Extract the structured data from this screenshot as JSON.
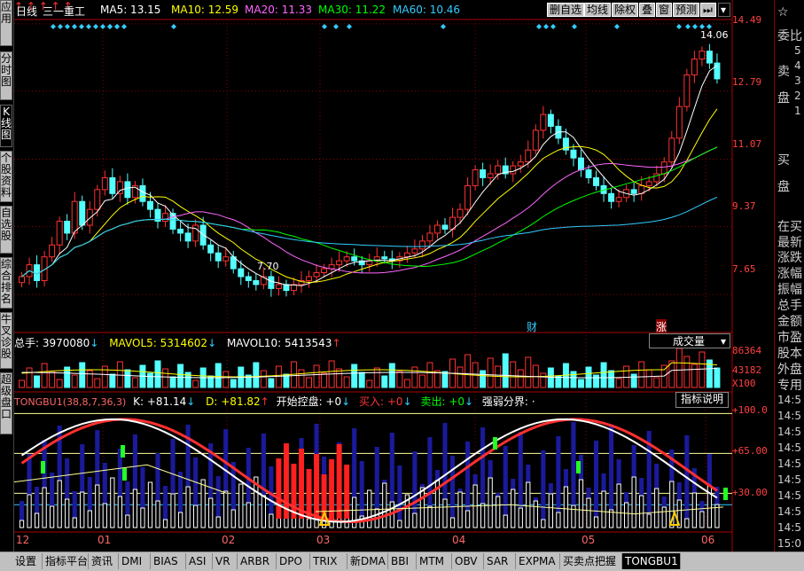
{
  "stock": {
    "chart_label": "日线",
    "name": "三一重工"
  },
  "ma_bar": [
    {
      "label": "MA5: 13.15",
      "color": "#ffffff"
    },
    {
      "label": "MA10: 12.59",
      "color": "#ffff00"
    },
    {
      "label": "MA20: 11.33",
      "color": "#ff66ff"
    },
    {
      "label": "MA30: 11.22",
      "color": "#00ff00"
    },
    {
      "label": "MA60: 10.46",
      "color": "#33ccff"
    }
  ],
  "toolbar": {
    "buttons": [
      "删自选",
      "均线",
      "除权",
      "叠",
      "窗",
      "预测"
    ]
  },
  "left_tabs": [
    "应用",
    "分时图",
    "K线图",
    "个股资料",
    "自选股",
    "综合排名",
    "牛叉诊股",
    "超级盘口"
  ],
  "price_axis": [
    "14.49",
    "12.79",
    "11.07",
    "9.37",
    "7.65"
  ],
  "annotations": {
    "high": "14.06",
    "low": "7.70",
    "event1": "财",
    "event2": "涨"
  },
  "volume_bar": {
    "total": "总手: 3970080",
    "mavol5": "MAVOL5: 5314602",
    "mavol10": "MAVOL10: 5413543",
    "selector": "成交量",
    "axis": [
      "86364",
      "43182",
      "X100"
    ]
  },
  "indicator_bar": {
    "name": "TONGBU1(38,8,7,36,3)",
    "k": "K: +81.14",
    "d": "D: +81.82",
    "kaishi": "开始控盘: +0",
    "mairu": "买入: +0",
    "maichu": "卖出: +0",
    "qiangruo": "强弱分界: ·",
    "help": "指标说明",
    "axis": [
      "+100.0",
      "+65.00",
      "+30.00"
    ]
  },
  "date_axis": [
    "12",
    "01",
    "02",
    "03",
    "04",
    "05",
    "06"
  ],
  "right_panel": {
    "labels": [
      "委比",
      "卖",
      "盘",
      "买",
      "盘",
      "在买",
      "最新",
      "涨跌",
      "涨幅",
      "振幅",
      "总手",
      "金额",
      "市盈",
      "股本",
      "外盘",
      "专用"
    ],
    "times": [
      "14:5",
      "14:5",
      "14:5",
      "14:5",
      "14:5",
      "14:5",
      "14:5",
      "14:5",
      "14:5",
      "15:0"
    ],
    "book": [
      "5",
      "4",
      "3",
      "2",
      "1"
    ]
  },
  "bottom_tabs": [
    "设置",
    "指标平台",
    "资讯",
    "DMI",
    "BIAS",
    "ASI",
    "VR",
    "ARBR",
    "DPO",
    "TRIX",
    "新DMA",
    "BBI",
    "MTM",
    "OBV",
    "SAR",
    "EXPMA",
    "买卖点把握",
    "TONGBU1"
  ],
  "chart_data": {
    "type": "candlestick",
    "ylim": [
      6.8,
      14.6
    ],
    "price_ticks": [
      14.49,
      12.79,
      11.07,
      9.37,
      7.65
    ],
    "candles_close": [
      8.1,
      8.4,
      8.0,
      8.6,
      8.9,
      9.5,
      9.2,
      10.0,
      9.4,
      9.8,
      10.3,
      10.6,
      10.2,
      10.5,
      10.1,
      10.4,
      10.0,
      9.8,
      9.5,
      9.7,
      9.3,
      9.2,
      9.0,
      9.4,
      8.9,
      8.7,
      8.5,
      8.6,
      8.3,
      8.1,
      8.0,
      7.9,
      8.1,
      7.8,
      7.9,
      7.75,
      7.9,
      8.0,
      8.1,
      8.2,
      8.3,
      8.4,
      8.5,
      8.6,
      8.5,
      8.4,
      8.5,
      8.6,
      8.55,
      8.5,
      8.6,
      8.7,
      8.8,
      9.0,
      9.2,
      9.4,
      9.3,
      9.6,
      9.8,
      10.4,
      10.8,
      10.6,
      10.7,
      10.9,
      10.7,
      10.9,
      11.0,
      11.3,
      11.8,
      12.2,
      11.9,
      11.6,
      11.3,
      11.1,
      10.8,
      10.6,
      10.4,
      10.2,
      10.0,
      10.1,
      10.3,
      10.2,
      10.4,
      10.5,
      10.7,
      11.0,
      11.6,
      12.4,
      13.2,
      13.6,
      13.8,
      13.5,
      13.1
    ],
    "ma_series": [
      "MA5",
      "MA10",
      "MA20",
      "MA30",
      "MA60"
    ],
    "volume_axis": [
      86364,
      43182
    ],
    "indicator_axis": [
      100.0,
      65.0,
      30.0
    ],
    "indicator_k": 81.14,
    "indicator_d": 81.82
  }
}
